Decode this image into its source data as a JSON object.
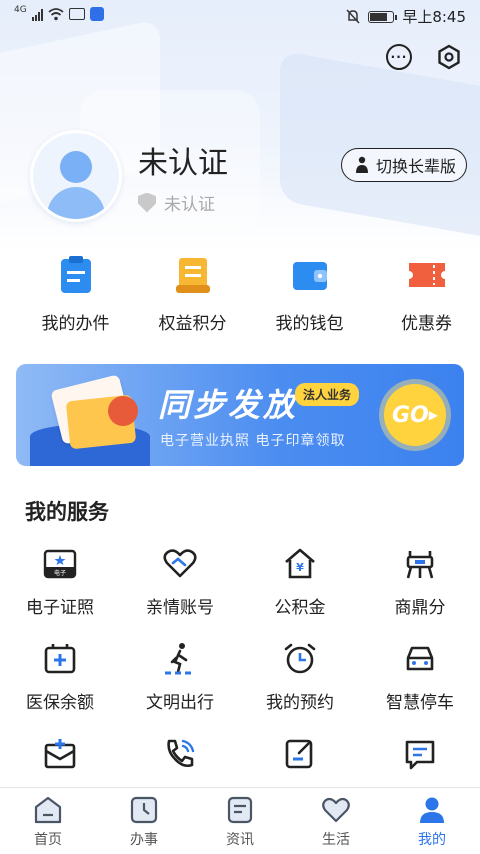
{
  "status_bar": {
    "network": "4G",
    "time": "早上8:45"
  },
  "profile": {
    "name": "未认证",
    "verify_status": "未认证",
    "elder_mode_label": "切换长辈版"
  },
  "quick_actions": [
    {
      "label": "我的办件",
      "color": "#2d8cf0"
    },
    {
      "label": "权益积分",
      "color": "#f5a623"
    },
    {
      "label": "我的钱包",
      "color": "#2d8cf0"
    },
    {
      "label": "优惠券",
      "color": "#f0603e"
    }
  ],
  "banner": {
    "title": "同步发放",
    "tag": "法人业务",
    "subtitle": "电子营业执照 电子印章领取",
    "go_label": "GO"
  },
  "services": {
    "title": "我的服务",
    "items": [
      {
        "label": "电子证照",
        "icon": "id-card-icon",
        "badge": "电子"
      },
      {
        "label": "亲情账号",
        "icon": "heart-handshake-icon"
      },
      {
        "label": "公积金",
        "icon": "house-yuan-icon"
      },
      {
        "label": "商鼎分",
        "icon": "tripod-icon"
      },
      {
        "label": "医保余额",
        "icon": "medical-card-icon"
      },
      {
        "label": "文明出行",
        "icon": "pedestrian-crossing-icon"
      },
      {
        "label": "我的预约",
        "icon": "alarm-clock-icon"
      },
      {
        "label": "智慧停车",
        "icon": "car-icon"
      },
      {
        "label": "",
        "icon": "medical-envelope-icon"
      },
      {
        "label": "",
        "icon": "phone-icon"
      },
      {
        "label": "",
        "icon": "edit-note-icon"
      },
      {
        "label": "",
        "icon": "message-icon"
      }
    ]
  },
  "tabs": [
    {
      "label": "首页",
      "icon": "home-icon"
    },
    {
      "label": "办事",
      "icon": "clock-icon"
    },
    {
      "label": "资讯",
      "icon": "news-icon"
    },
    {
      "label": "生活",
      "icon": "heart-icon"
    },
    {
      "label": "我的",
      "icon": "user-icon",
      "active": true
    }
  ],
  "accent_color": "#2d76ea"
}
